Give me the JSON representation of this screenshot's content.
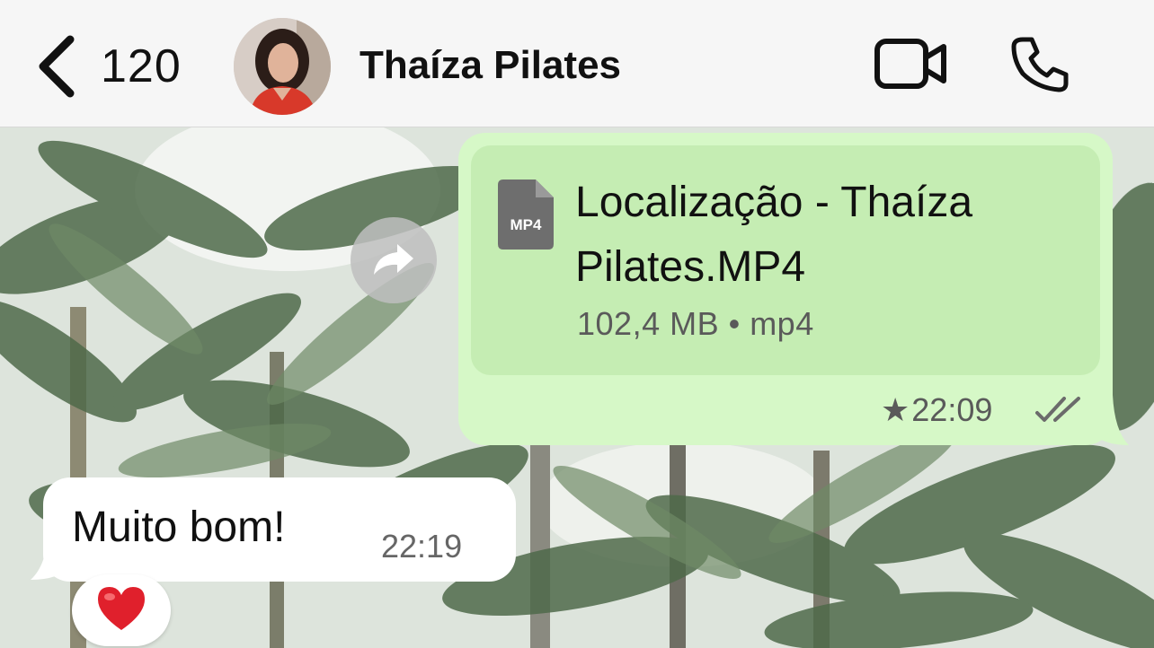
{
  "header": {
    "back_count": "120",
    "contact_name": "Thaíza Pilates",
    "icons": [
      "chevron-left-icon",
      "video-camera-icon",
      "phone-icon"
    ]
  },
  "messages": {
    "outgoing_file": {
      "file_type_label": "MP4",
      "file_name": "Localização - Thaíza Pilates.MP4",
      "file_meta": "102,4 MB • mp4",
      "starred": true,
      "time": "22:09",
      "status": "read"
    },
    "incoming": {
      "text": "Muito bom!",
      "time": "22:19",
      "reaction": "heart"
    }
  },
  "colors": {
    "outgoing_bubble": "#d6f8c7",
    "file_card": "#c5edb3",
    "incoming_bubble": "#ffffff",
    "header_bg": "#f6f6f6",
    "heart": "#e0202c"
  }
}
